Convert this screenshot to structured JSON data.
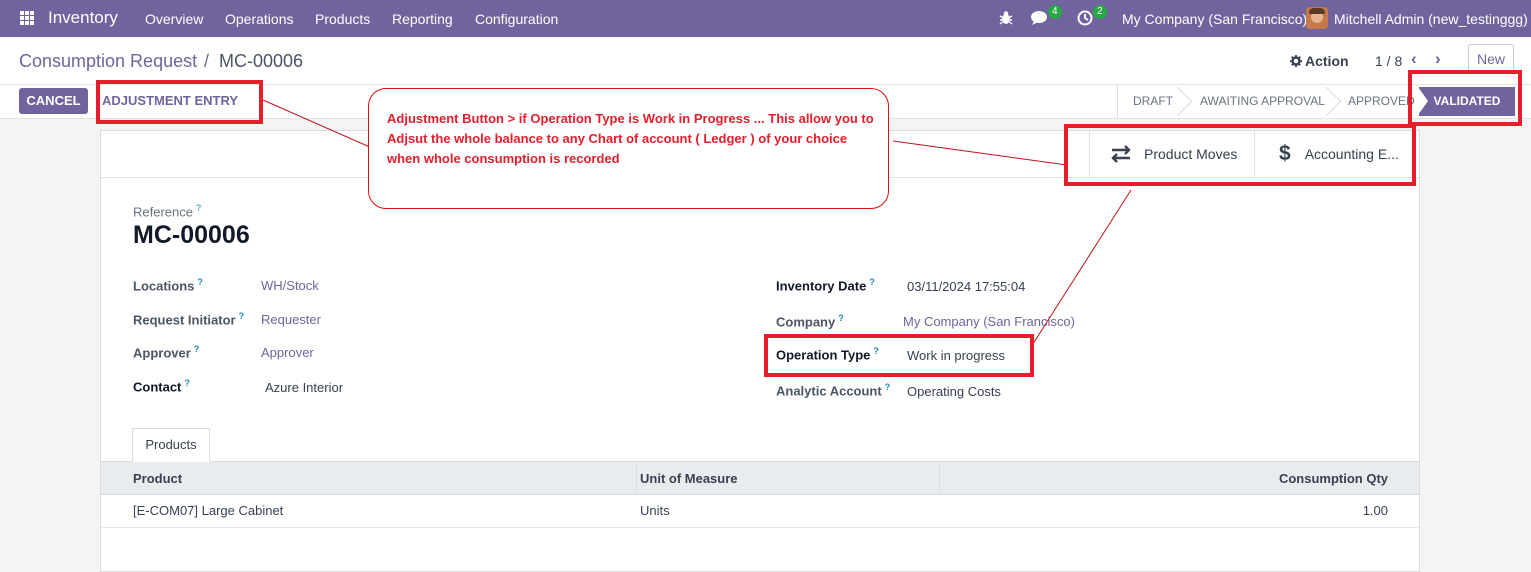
{
  "topnav": {
    "app_name": "Inventory",
    "menu": [
      "Overview",
      "Operations",
      "Products",
      "Reporting",
      "Configuration"
    ],
    "messages_count": "4",
    "activities_count": "2",
    "company": "My Company (San Francisco)",
    "user": "Mitchell Admin (new_testinggg)",
    "icons": [
      "apps-grid-icon",
      "bug-icon",
      "chat-icon",
      "clock-icon"
    ]
  },
  "control_panel": {
    "breadcrumb_parent": "Consumption Request",
    "breadcrumb_separator": "/",
    "record_name": "MC-00006",
    "action_label": "Action",
    "pager": "1 / 8",
    "new_label": "New"
  },
  "statusbar": {
    "cancel_label": "CANCEL",
    "adjustment_label": "ADJUSTMENT ENTRY",
    "stages": [
      "DRAFT",
      "AWAITING APPROVAL",
      "APPROVED"
    ],
    "active_stage": "VALIDATED"
  },
  "smart_buttons": {
    "product_moves": "Product Moves",
    "accounting": "Accounting E..."
  },
  "form": {
    "reference_label": "Reference",
    "reference": "MC-00006",
    "locations_label": "Locations",
    "locations": "WH/Stock",
    "initiator_label": "Request Initiator",
    "initiator": "Requester",
    "approver_label": "Approver",
    "approver": "Approver",
    "contact_label": "Contact",
    "contact": "Azure Interior",
    "inventory_date_label": "Inventory Date",
    "inventory_date": "03/11/2024 17:55:04",
    "company_label": "Company",
    "company": "My Company (San Francisco)",
    "operation_type_label": "Operation Type",
    "operation_type": "Work in progress",
    "analytic_label": "Analytic Account",
    "analytic": "Operating Costs",
    "help_mark": "?"
  },
  "products_tab": {
    "tab_label": "Products",
    "columns": [
      "Product",
      "Unit of Measure",
      "Consumption Qty"
    ],
    "rows": [
      {
        "product": "[E-COM07] Large Cabinet",
        "uom": "Units",
        "qty": "1.00"
      }
    ]
  },
  "annotation": {
    "callout_text": "Adjustment Button > if Operation Type is Work in Progress ... This allow you to Adjsut the whole balance to any  Chart of account ( Ledger ) of your choice  when whole consumption is recorded",
    "color": "#e41e2b"
  },
  "colors": {
    "brand": "#71639e",
    "link": "#71639e",
    "badge": "#28a745"
  }
}
